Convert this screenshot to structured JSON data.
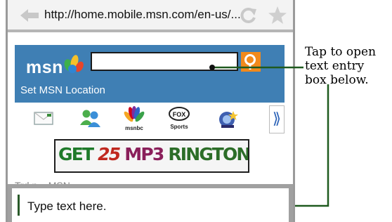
{
  "browser": {
    "url": "http://home.mobile.msn.com/en-us/..."
  },
  "msn": {
    "logo_text": "msn",
    "search": {
      "value": ""
    },
    "location_link": "Set MSN Location",
    "shortcuts": [
      {
        "name": "mail",
        "caption": ""
      },
      {
        "name": "messenger",
        "caption": ""
      },
      {
        "name": "msnbc",
        "caption": "msnbc"
      },
      {
        "name": "fox-sports",
        "caption": "Sports",
        "badge": "FOX"
      },
      {
        "name": "games",
        "caption": ""
      }
    ],
    "more_glyph": "⟫"
  },
  "ad": {
    "segments": [
      {
        "text": "GET ",
        "color": "#1f7a2a"
      },
      {
        "text": "25 ",
        "color": "#c0281f",
        "italic": true
      },
      {
        "text": "MP3 ",
        "color": "#8a1f5a"
      },
      {
        "text": "RINGTONES",
        "color": "#2c6d28"
      }
    ]
  },
  "under_text": "Trd n... MSN",
  "entry": {
    "placeholder": "Type text here."
  },
  "annotation": {
    "text": "Tap to open\ntext entry\nbox below."
  },
  "colors": {
    "msn_blue": "#3f7fb4",
    "search_orange": "#f28a1c",
    "callout_green": "#1f5a1f"
  }
}
